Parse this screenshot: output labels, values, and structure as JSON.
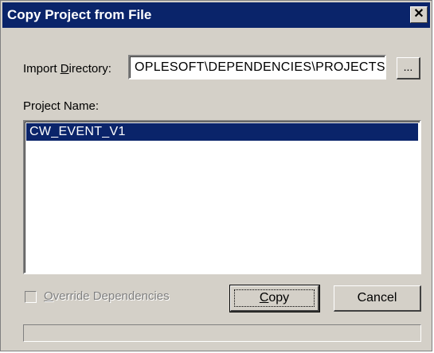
{
  "window": {
    "title": "Copy Project from File",
    "close_glyph": "✕"
  },
  "import_directory": {
    "label_prefix": "Import ",
    "label_accel": "D",
    "label_suffix": "irectory:",
    "value": "OPLESOFT\\DEPENDENCIES\\PROJECTS",
    "browse_label": "..."
  },
  "project_list": {
    "label": "Project Name:",
    "items": [
      {
        "name": "CW_EVENT_V1",
        "selected": true
      }
    ]
  },
  "override_dependencies": {
    "label_accel": "O",
    "label_rest": "verride Dependencies",
    "checked": false,
    "enabled": false
  },
  "buttons": {
    "copy_accel": "C",
    "copy_rest": "opy",
    "cancel": "Cancel"
  },
  "status_text": "",
  "colors": {
    "titlebar": "#0a246a",
    "dialog_face": "#d4d0c8",
    "selection": "#0a246a"
  }
}
